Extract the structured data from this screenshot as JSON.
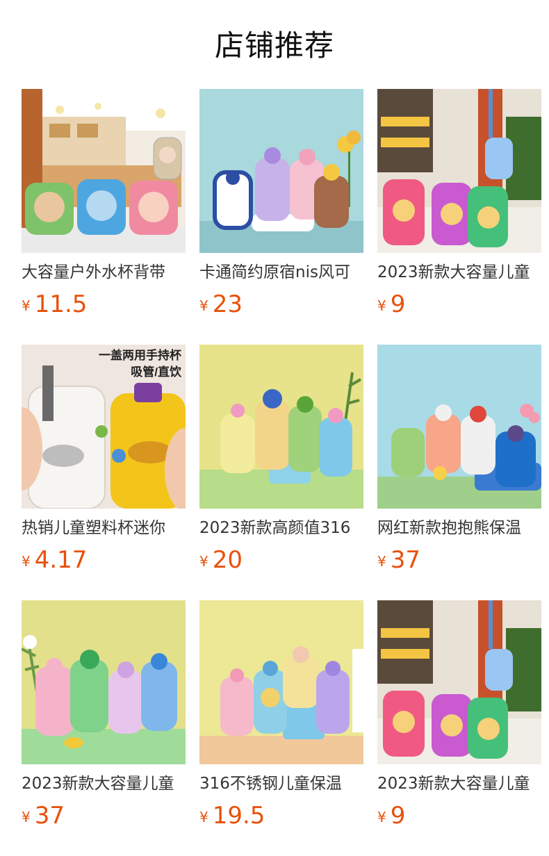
{
  "section": {
    "title": "店铺推荐"
  },
  "currency": "¥",
  "products": [
    {
      "name": "大容量户外水杯背带",
      "price": "11.5",
      "image_icon": "kids-water-bottles-photo",
      "image_text": ""
    },
    {
      "name": "卡通简约原宿nis风可",
      "price": "23",
      "image_icon": "kids-water-bottles-photo",
      "image_text": ""
    },
    {
      "name": "2023新款大容量儿童",
      "price": "9",
      "image_icon": "kids-water-bottles-photo",
      "image_text": ""
    },
    {
      "name": "热销儿童塑料杯迷你",
      "price": "4.17",
      "image_icon": "kids-water-bottles-photo",
      "image_text": "一盖两用手持杯\n吸管/直饮"
    },
    {
      "name": "2023新款高颜值316",
      "price": "20",
      "image_icon": "kids-water-bottles-photo",
      "image_text": ""
    },
    {
      "name": "网红新款抱抱熊保温",
      "price": "37",
      "image_icon": "kids-water-bottles-photo",
      "image_text": ""
    },
    {
      "name": "2023新款大容量儿童",
      "price": "37",
      "image_icon": "kids-water-bottles-photo",
      "image_text": ""
    },
    {
      "name": "316不锈钢儿童保温",
      "price": "19.5",
      "image_icon": "kids-water-bottles-photo",
      "image_text": ""
    },
    {
      "name": "2023新款大容量儿童",
      "price": "9",
      "image_icon": "kids-water-bottles-photo",
      "image_text": ""
    }
  ],
  "colors": {
    "price": "#e8510a",
    "title": "#111111",
    "name": "#333333"
  }
}
